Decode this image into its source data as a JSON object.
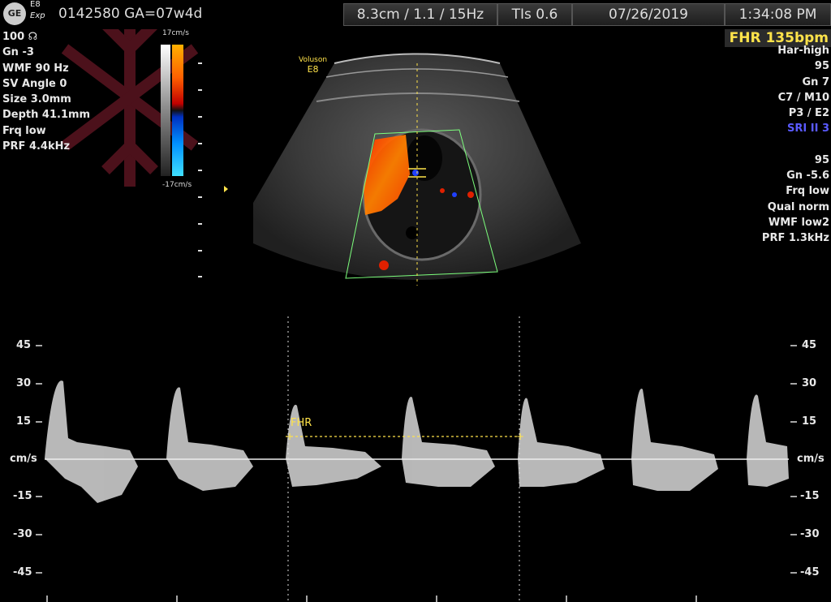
{
  "header": {
    "logo": "GE",
    "probe_line1": "E8",
    "probe_line2": "Exp",
    "patient_info": "0142580  GA=07w4d",
    "imaging_params": "8.3cm / 1.1 / 15Hz",
    "tis": "TIs  0.6",
    "date": "07/26/2019",
    "time": "1:34:08 PM"
  },
  "left_params": [
    "100  ☊",
    "Gn  -3",
    "WMF 90 Hz",
    "SV Angle  0",
    "Size  3.0mm",
    "Depth 41.1mm",
    "Frq low",
    "PRF  4.4kHz"
  ],
  "right_params_top": [
    "Har-high",
    "95",
    "Gn  7",
    "C7 / M10",
    "P3 / E2"
  ],
  "right_params_sri": "SRI II 3",
  "right_params_bottom": [
    "95",
    "Gn -5.6",
    "Frq low",
    "Qual norm",
    "WMF low2",
    "PRF  1.3kHz"
  ],
  "fhr_result": "FHR 135bpm",
  "color_scale": {
    "top": "17cm/s",
    "bottom": "-17cm/s"
  },
  "voluson": {
    "line1": "Voluson",
    "line2": "E8"
  },
  "doppler": {
    "unit": "cm/s",
    "ticks": [
      "45",
      "30",
      "15",
      "-15",
      "-30",
      "-45"
    ],
    "fhr_caliper_label": "FHR"
  },
  "colors": {
    "accent": "#ffe34a",
    "flow_red": "#ff4000",
    "flow_blue": "#2040ff",
    "roi": "#7dff7d"
  }
}
